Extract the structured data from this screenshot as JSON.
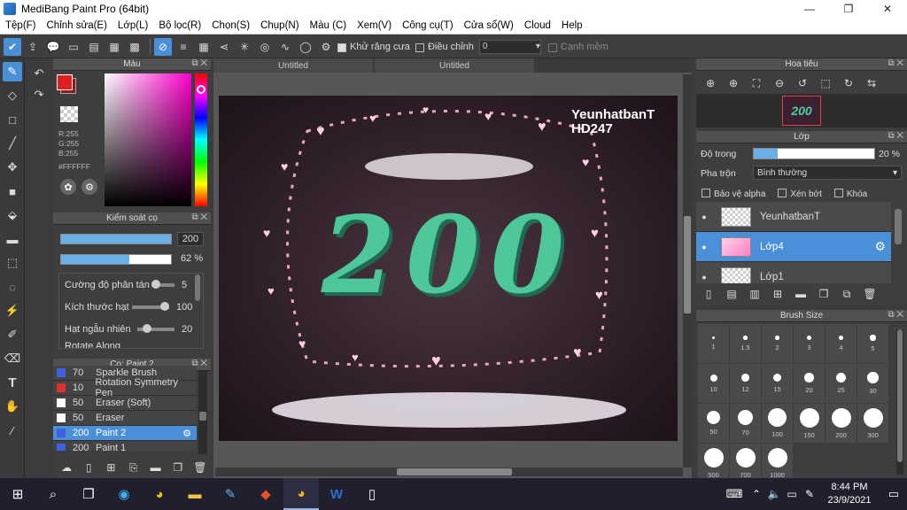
{
  "window": {
    "title": "MediBang Paint Pro (64bit)"
  },
  "menu": [
    "Tệp(F)",
    "Chỉnh sửa(E)",
    "Lớp(L)",
    "Bộ lọc(R)",
    "Chọn(S)",
    "Chụp(N)",
    "Màu (C)",
    "Xem(V)",
    "Công cụ(T)",
    "Cửa sổ(W)",
    "Cloud",
    "Help"
  ],
  "toolbar": {
    "antialias_label": "Khử răng cưa",
    "adjust_label": "Điều chỉnh",
    "adjust_value": "0",
    "soft_edge_label": "Cạnh mềm"
  },
  "color_panel": {
    "title": "Màu",
    "r": "R:255",
    "g": "G:255",
    "b": "B:255",
    "hex": "#FFFFFF"
  },
  "brush_control": {
    "title": "Kiểm soát cọ",
    "size_value": "200",
    "opacity_value": "62",
    "opacity_unit": "%",
    "opacity_fraction": 0.62,
    "params": [
      {
        "label": "Cường độ phân tán",
        "value": "5"
      },
      {
        "label": "Kích thước hạt",
        "value": "100"
      },
      {
        "label": "Hạt ngẫu nhiên",
        "value": "20"
      },
      {
        "label": "Rotate Along",
        "value": ""
      }
    ]
  },
  "brush_list": {
    "title": "Cọ: Paint 2",
    "items": [
      {
        "size": "70",
        "name": "Sparkle Brush",
        "color": "#4060e0"
      },
      {
        "size": "10",
        "name": "Rotation Symmetry Pen",
        "color": "#e03030"
      },
      {
        "size": "50",
        "name": "Eraser (Soft)",
        "color": "#ffffff"
      },
      {
        "size": "50",
        "name": "Eraser",
        "color": "#ffffff"
      },
      {
        "size": "200",
        "name": "Paint 2",
        "color": "#4060e0",
        "selected": true
      },
      {
        "size": "200",
        "name": "Paint 1",
        "color": "#4060e0"
      }
    ]
  },
  "tabs": [
    "Untitled",
    "Untitled"
  ],
  "artwork": {
    "watermark_line1": "YeunhatbanT",
    "watermark_line2": "HD247",
    "big_text": "200"
  },
  "navigator": {
    "title": "Hoa tiêu"
  },
  "layers": {
    "title": "Lớp",
    "opacity_label": "Độ trong",
    "opacity_value": "20",
    "opacity_unit": "%",
    "opacity_fraction": 0.2,
    "blend_label": "Pha trộn",
    "blend_value": "Bình thường",
    "protect_alpha": "Bảo vệ alpha",
    "clip": "Xén bớt",
    "lock": "Khóa",
    "items": [
      {
        "name": "YeunhatbanT",
        "selected": false
      },
      {
        "name": "Lớp4",
        "selected": true
      },
      {
        "name": "Lớp1",
        "selected": false
      }
    ]
  },
  "brush_size": {
    "title": "Brush Size",
    "sizes": [
      "1",
      "1.5",
      "2",
      "3",
      "4",
      "5",
      "10",
      "12",
      "15",
      "20",
      "25",
      "30",
      "50",
      "70",
      "100",
      "150",
      "200",
      "300",
      "500",
      "700",
      "1000"
    ]
  },
  "taskbar": {
    "time": "8:44 PM",
    "date": "23/9/2021"
  },
  "colors": {
    "accent": "#4a90d9",
    "foreground": "#e02020",
    "background": "#8a1a1a"
  }
}
